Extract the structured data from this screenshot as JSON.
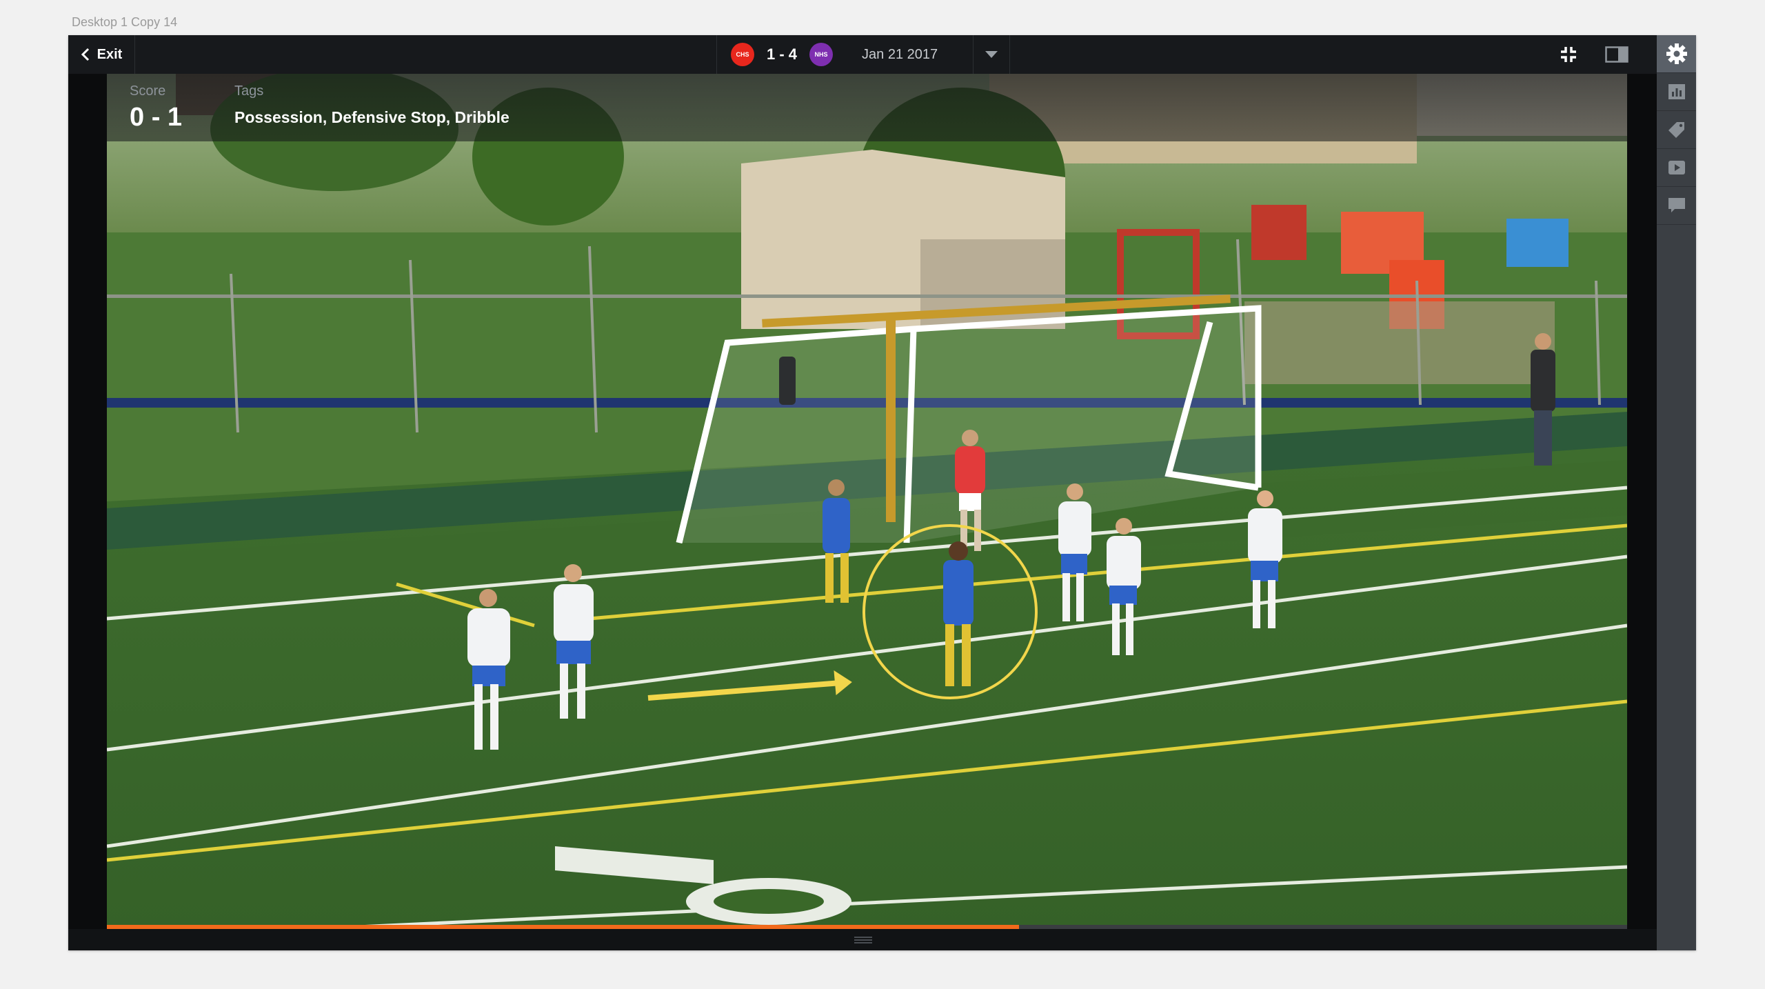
{
  "artboard": {
    "label": "Desktop 1 Copy 14"
  },
  "topbar": {
    "exit_label": "Exit",
    "home_team": {
      "abbr": "CHS",
      "color": "#e8271d"
    },
    "away_team": {
      "abbr": "NHS",
      "color": "#7e2fb0"
    },
    "match_score": "1 - 4",
    "match_date": "Jan 21 2017"
  },
  "overlay": {
    "score_label": "Score",
    "score_value": "0 - 1",
    "tags_label": "Tags",
    "tags_value": "Possession, Defensive Stop, Dribble"
  },
  "player": {
    "progress": 0.6
  },
  "sidebar": {
    "items": [
      {
        "icon": "gear-icon",
        "active": true
      },
      {
        "icon": "bar-chart-icon",
        "active": false
      },
      {
        "icon": "tag-icon",
        "active": false
      },
      {
        "icon": "video-clip-icon",
        "active": false
      },
      {
        "icon": "comment-icon",
        "active": false
      }
    ]
  },
  "colors": {
    "accent": "#f26a1b",
    "highlight": "#f2d64b",
    "topbar_bg": "#17191c",
    "sidebar_bg": "#3b3f44"
  }
}
